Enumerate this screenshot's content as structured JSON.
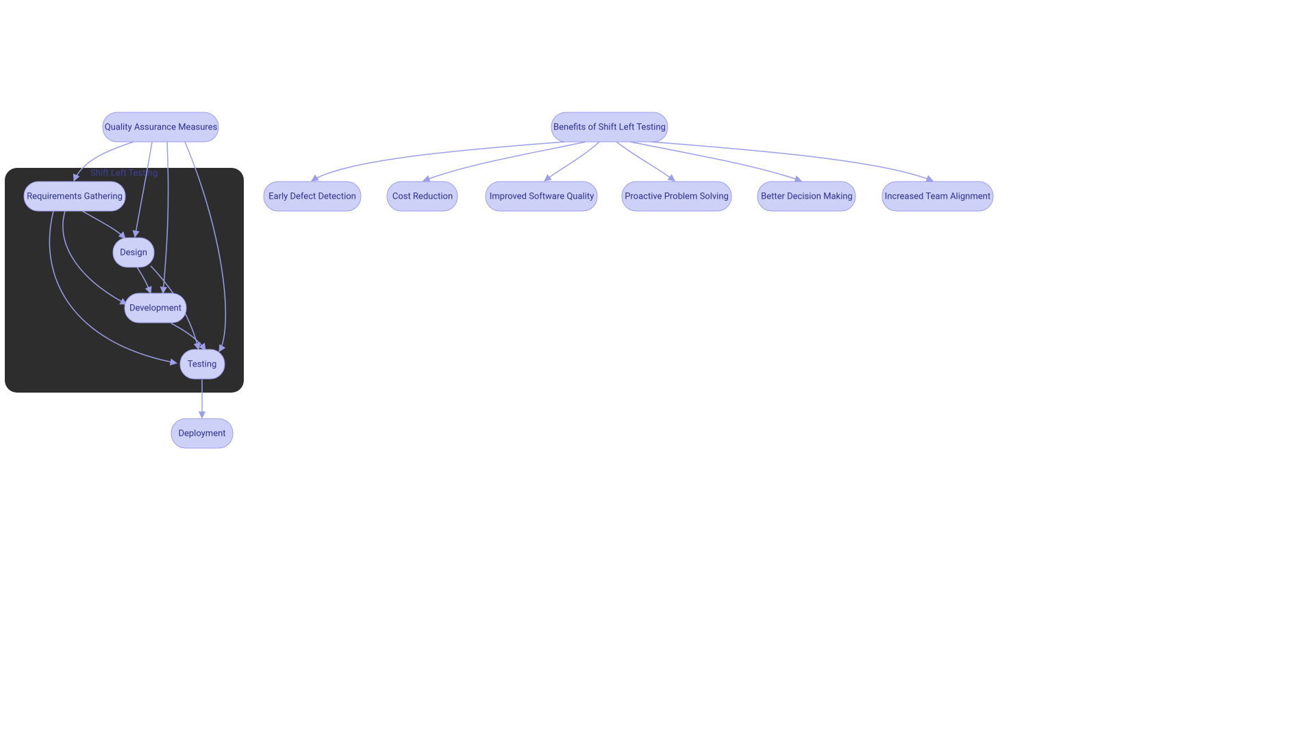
{
  "colors": {
    "nodeFill": "#cdd0f7",
    "nodeStroke": "#9b9ee8",
    "nodeText": "#2c2f8e",
    "subgraphFill": "#2d2d2d",
    "edge": "#9b9ee8"
  },
  "subgraph": {
    "label": "Shift Left Testing"
  },
  "nodes": {
    "qa": "Quality Assurance Measures",
    "req": "Requirements Gathering",
    "design": "Design",
    "dev": "Development",
    "testing": "Testing",
    "deploy": "Deployment",
    "benefits": "Benefits of Shift Left Testing",
    "b1": "Early Defect Detection",
    "b2": "Cost Reduction",
    "b3": "Improved Software Quality",
    "b4": "Proactive Problem Solving",
    "b5": "Better Decision Making",
    "b6": "Increased Team Alignment"
  }
}
